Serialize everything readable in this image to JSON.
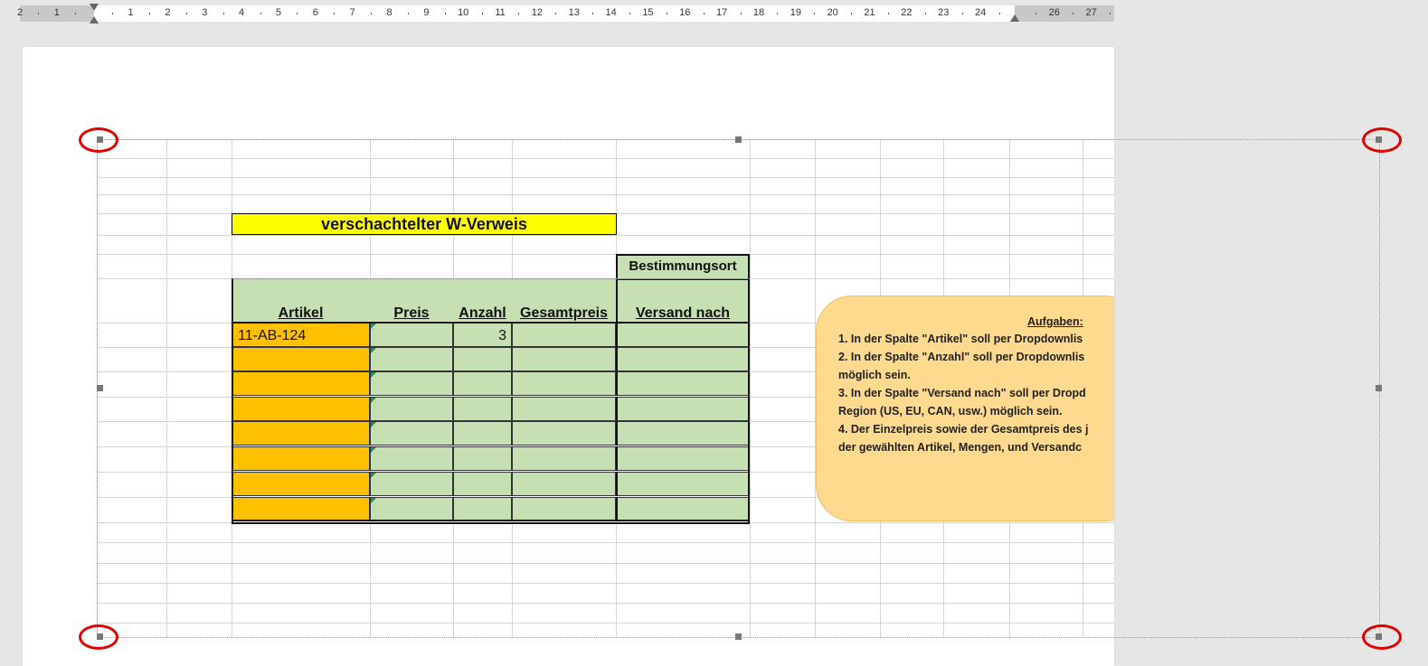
{
  "ruler": {
    "labels": [
      "2",
      "1",
      "",
      "1",
      "2",
      "3",
      "4",
      "5",
      "6",
      "7",
      "8",
      "9",
      "10",
      "11",
      "12",
      "13",
      "14",
      "15",
      "16",
      "17",
      "18",
      "19",
      "20",
      "21",
      "22",
      "23",
      "24",
      "",
      "26",
      "27"
    ]
  },
  "sheet": {
    "title": "verschachtelter W-Verweis",
    "group_header": "Bestimmungsort",
    "columns": [
      "Artikel",
      "Preis",
      "Anzahl",
      "Gesamtpreis",
      "Versand nach"
    ],
    "rows": [
      [
        "11-AB-124",
        "",
        "3",
        "",
        ""
      ],
      [
        "",
        "",
        "",
        "",
        ""
      ],
      [
        "",
        "",
        "",
        "",
        ""
      ],
      [
        "",
        "",
        "",
        "",
        ""
      ],
      [
        "",
        "",
        "",
        "",
        ""
      ],
      [
        "",
        "",
        "",
        "",
        ""
      ],
      [
        "",
        "",
        "",
        "",
        ""
      ],
      [
        "",
        "",
        "",
        "",
        ""
      ]
    ]
  },
  "callout": {
    "heading": "Aufgaben:",
    "lines": [
      "1. In der Spalte \"Artikel\" soll per Dropdownlis",
      "2. In der Spalte \"Anzahl\" soll per Dropdownlis",
      "möglich sein.",
      "3. In der Spalte \"Versand nach\" soll per Dropd",
      "Region (US, EU, CAN, usw.) möglich sein.",
      "4. Der Einzelpreis sowie der Gesamtpreis des j",
      "der gewählten Artikel, Mengen, und Versandc"
    ]
  },
  "colors": {
    "title_fill": "#ffff00",
    "header_fill": "#c6e0b4",
    "artikel_fill": "#ffc000",
    "callout_fill": "#ffd98e",
    "highlight_circle": "#e00000"
  }
}
